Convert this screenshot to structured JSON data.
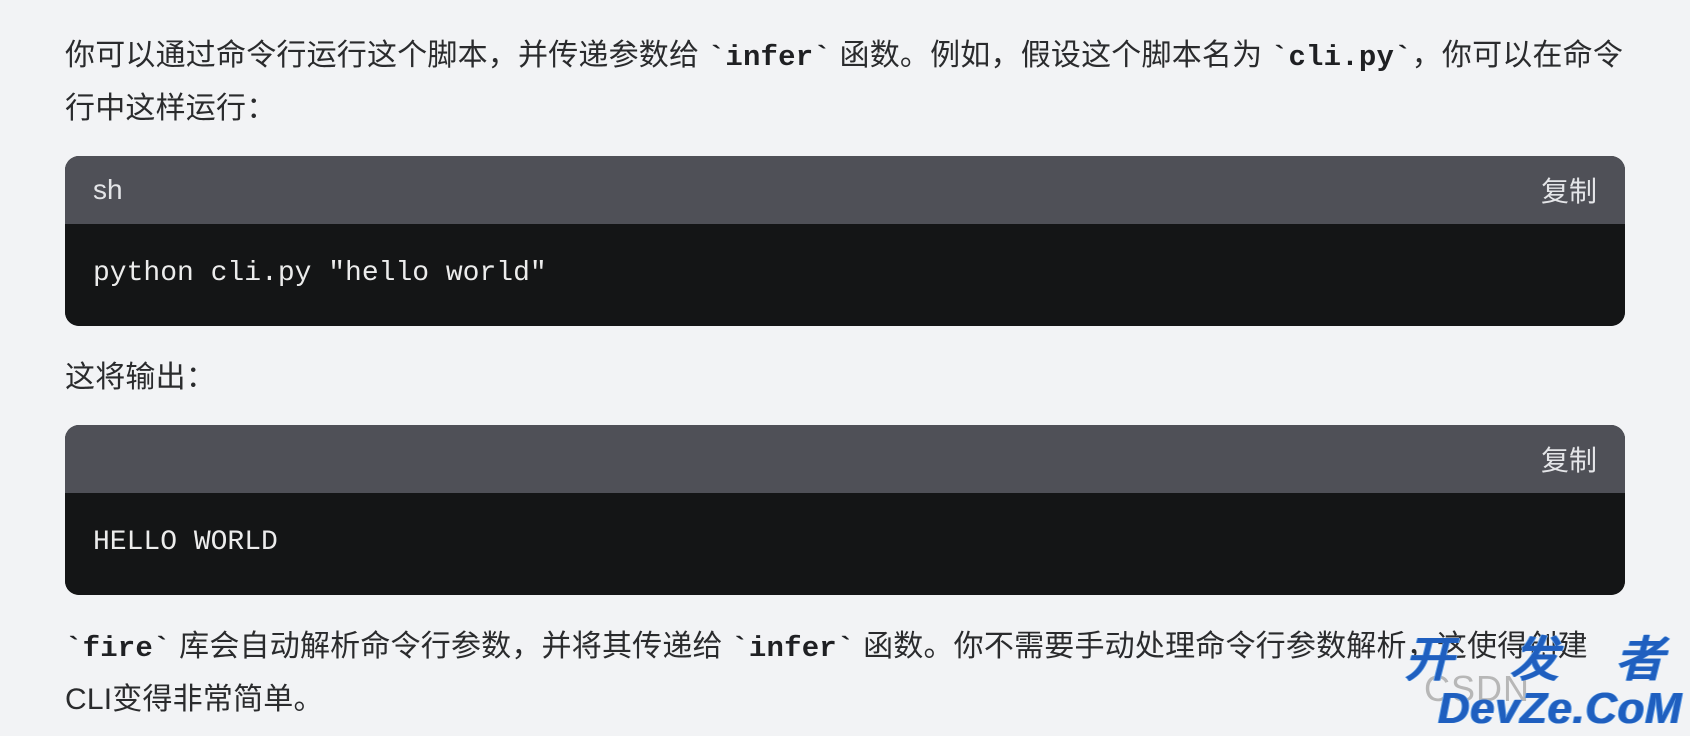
{
  "paragraph1": {
    "part1": "你可以通过命令行运行这个脚本，并传递参数给 ",
    "code1": "`infer`",
    "part2": " 函数。例如，假设这个脚本名为 ",
    "code2": "`cli.py`",
    "part3": "，你可以在命令行中这样运行："
  },
  "codeblock1": {
    "lang": "sh",
    "copy": "复制",
    "body": "python cli.py \"hello world\""
  },
  "paragraph2": "这将输出：",
  "codeblock2": {
    "lang": "",
    "copy": "复制",
    "body": "HELLO WORLD"
  },
  "paragraph3": {
    "part1": "",
    "code1": "`fire`",
    "part2": " 库会自动解析命令行参数，并将其传递给 ",
    "code2": "`infer`",
    "part3": " 函数。你不需要手动处理命令行参数解析，这使得创建CLI变得非常简单。"
  },
  "watermark_csdn": "CSDN",
  "watermark_devze_top": "开 发 者",
  "watermark_devze_bottom": "DevZe.CoM"
}
